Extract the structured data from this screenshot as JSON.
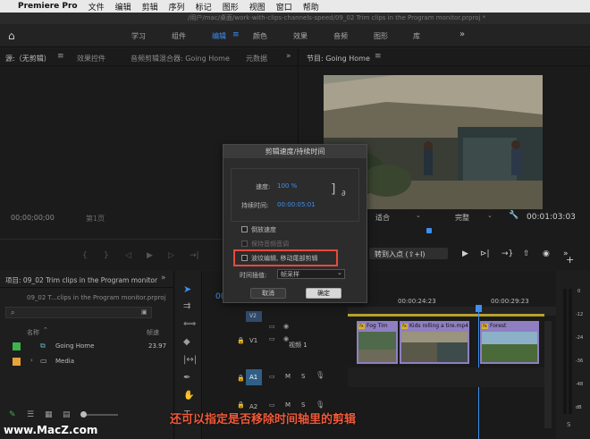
{
  "menubar": {
    "apple": "",
    "app": "Premiere Pro",
    "items": [
      "文件",
      "编辑",
      "剪辑",
      "序列",
      "标记",
      "图形",
      "视图",
      "窗口",
      "帮助"
    ]
  },
  "titlebar": {
    "path": "/用户/mac/桌面/work-with-clips-channels-speed/09_02 Trim clips in the Program monitor.prproj *"
  },
  "workspaces": {
    "items": [
      "学习",
      "组件",
      "编辑",
      "颜色",
      "效果",
      "音频",
      "图形",
      "库"
    ],
    "active": "编辑",
    "more": "»"
  },
  "source_panel": {
    "tabs": [
      "源:（无剪辑）",
      "效果控件",
      "音频剪辑混合器: Going Home",
      "元数据"
    ],
    "timecode": "00;00;00;00",
    "page": "第1页"
  },
  "program_panel": {
    "title": "节目: Going Home",
    "zoom": "适合",
    "quality": "完整",
    "timecode": "00:01:03:03",
    "insert_label": "转到入点 (⇧+I)"
  },
  "dialog": {
    "title": "剪辑速度/持续时间",
    "speed_label": "速度:",
    "speed_value": "100 %",
    "duration_label": "持续时间:",
    "duration_value": "00:00:05:01",
    "reverse_label": "倒放速度",
    "keep_pitch_label": "保持音频音调",
    "ripple_label": "波纹编辑, 移动尾部剪辑",
    "interp_label": "时间插值:",
    "interp_value": "帧采样",
    "cancel": "取消",
    "ok": "确定"
  },
  "project_panel": {
    "title": "项目: 09_02 Trim clips in the Program monitor",
    "file": "09_02 T...clips in the Program monitor.prproj",
    "col_name": "名称",
    "col_rate": "帧速",
    "items": [
      {
        "name": "Going Home",
        "rate": "23.97",
        "color": "#3cb44b"
      },
      {
        "name": "Media",
        "rate": "",
        "color": "#e8a23a"
      }
    ]
  },
  "timeline": {
    "timecodes": [
      "00:00:24:23",
      "00:00:29:23"
    ],
    "playhead_tc": "00",
    "tracks": {
      "v2": "V2",
      "v1": "V1",
      "v1_name": "视频 1",
      "a1": "A1",
      "a2": "A2",
      "m": "M",
      "s": "S"
    },
    "clips": [
      {
        "label": "Fog Tim"
      },
      {
        "label": "Kids rolling a tire.mp4"
      },
      {
        "label": "Forest"
      }
    ]
  },
  "meters": {
    "labels": [
      "0",
      "-12",
      "-24",
      "-36",
      "-48",
      "dB"
    ]
  },
  "caption": "还可以指定是否移除时间轴里的剪辑",
  "watermark": "www.MacZ.com"
}
